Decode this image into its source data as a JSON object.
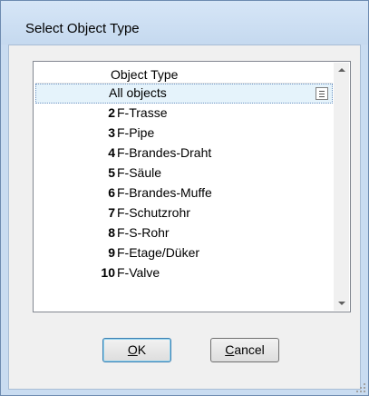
{
  "window": {
    "title": "Select Object Type"
  },
  "list": {
    "header": "Object Type",
    "rows": [
      {
        "num": "",
        "name": "All objects"
      },
      {
        "num": "2",
        "name": "F-Trasse"
      },
      {
        "num": "3",
        "name": "F-Pipe"
      },
      {
        "num": "4",
        "name": "F-Brandes-Draht"
      },
      {
        "num": "5",
        "name": "F-Säule"
      },
      {
        "num": "6",
        "name": "F-Brandes-Muffe"
      },
      {
        "num": "7",
        "name": "F-Schutzrohr"
      },
      {
        "num": "8",
        "name": "F-S-Rohr"
      },
      {
        "num": "9",
        "name": "F-Etage/Düker"
      },
      {
        "num": "10",
        "name": "F-Valve"
      }
    ]
  },
  "buttons": {
    "ok": {
      "mnemonic": "O",
      "rest": "K"
    },
    "cancel": {
      "mnemonic": "C",
      "rest": "ancel"
    }
  }
}
